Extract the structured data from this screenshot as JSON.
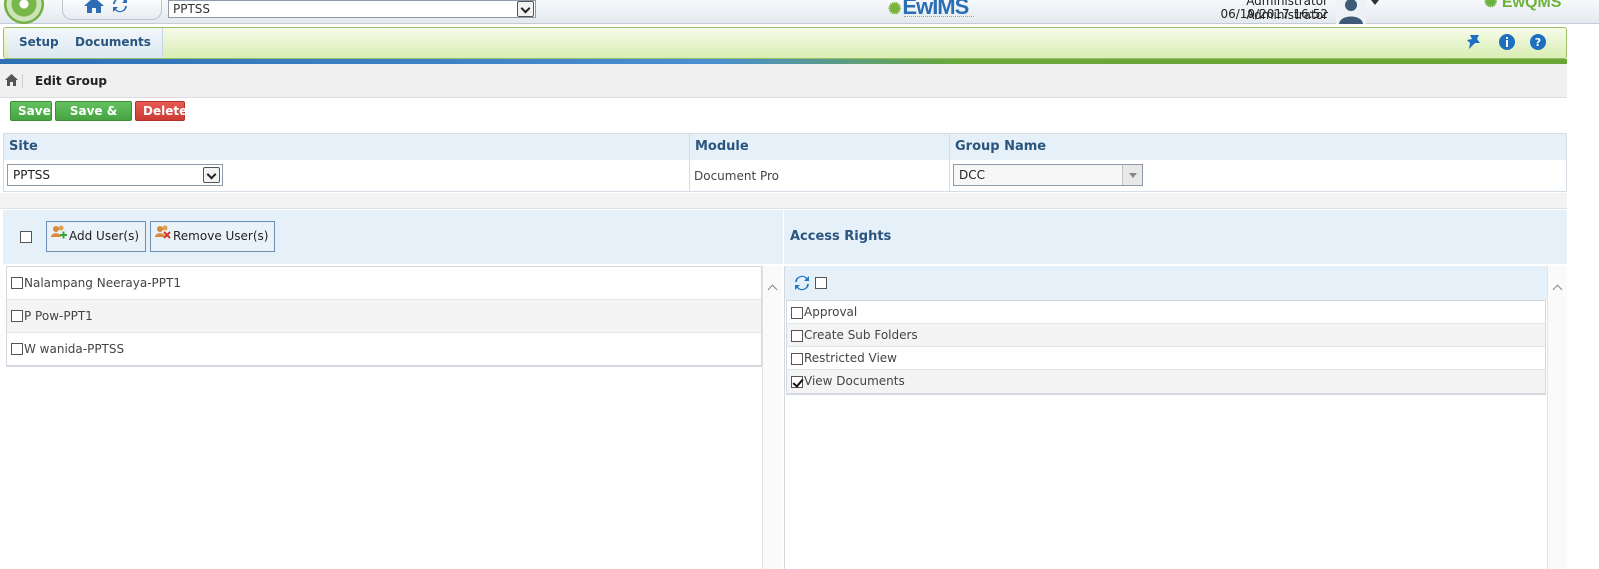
{
  "topbar": {
    "site_value": "PPTSS",
    "brand_center": "EwIMS",
    "brand_right": "EwQMS",
    "user_name": "Administrator Administrator",
    "datetime": "06/19/2017 16:52"
  },
  "menu": {
    "items": [
      {
        "label": "Setup"
      },
      {
        "label": "Documents"
      }
    ]
  },
  "breadcrumb": {
    "title": "Edit Group"
  },
  "toolbar": {
    "save_label": "Save",
    "save_add_label": "Save & Add",
    "delete_label": "Delete"
  },
  "form": {
    "site_header": "Site",
    "module_header": "Module",
    "group_header": "Group Name",
    "site_value": "PPTSS",
    "module_value": "Document Pro",
    "group_value": "DCC"
  },
  "users": {
    "add_label": "Add User(s)",
    "remove_label": "Remove User(s)",
    "items": [
      {
        "label": "Nalampang Neeraya-PPT1",
        "checked": false
      },
      {
        "label": "P Pow-PPT1",
        "checked": false
      },
      {
        "label": "W wanida-PPTSS",
        "checked": false
      }
    ]
  },
  "access": {
    "title": "Access Rights",
    "items": [
      {
        "label": "Approval",
        "checked": false
      },
      {
        "label": "Create Sub Folders",
        "checked": false
      },
      {
        "label": "Restricted View",
        "checked": false
      },
      {
        "label": "View Documents",
        "checked": true
      }
    ]
  },
  "colors": {
    "accent_blue": "#2a557e",
    "save_green": "#4cae47",
    "delete_red": "#d9433c",
    "header_bg": "#e6f0f8"
  },
  "icons": [
    "home-icon",
    "refresh-icon",
    "user-avatar-icon",
    "pin-icon",
    "info-icon",
    "help-icon",
    "add-user-icon",
    "remove-user-icon"
  ]
}
